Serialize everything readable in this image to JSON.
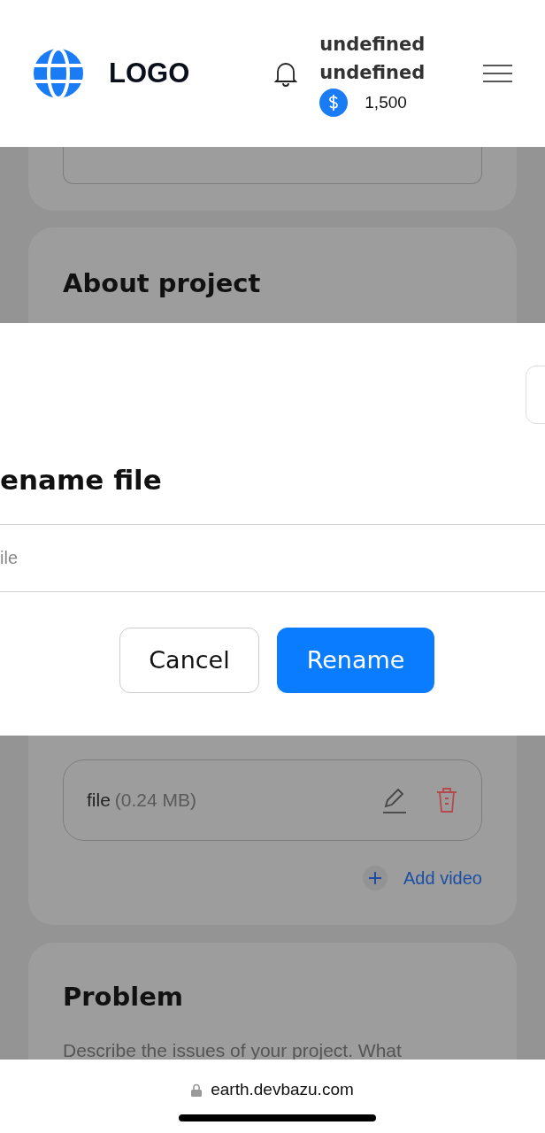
{
  "header": {
    "logo_text": "LOGO",
    "user_lines": [
      "undefined",
      "undefined"
    ],
    "balance": "1,500"
  },
  "about_section": {
    "title": "About project"
  },
  "file_item": {
    "name": "file",
    "size": "(0.24 MB)"
  },
  "add_video": "Add video",
  "problem_section": {
    "title": "Problem",
    "description": "Describe the issues of your project. What"
  },
  "dialog": {
    "title": "ename file",
    "placeholder": "ile",
    "buttons": [
      {
        "label": "Cancel",
        "kind": "secondary"
      },
      {
        "label": "Rename",
        "kind": "primary"
      }
    ]
  },
  "browser": {
    "url": "earth.devbazu.com"
  }
}
